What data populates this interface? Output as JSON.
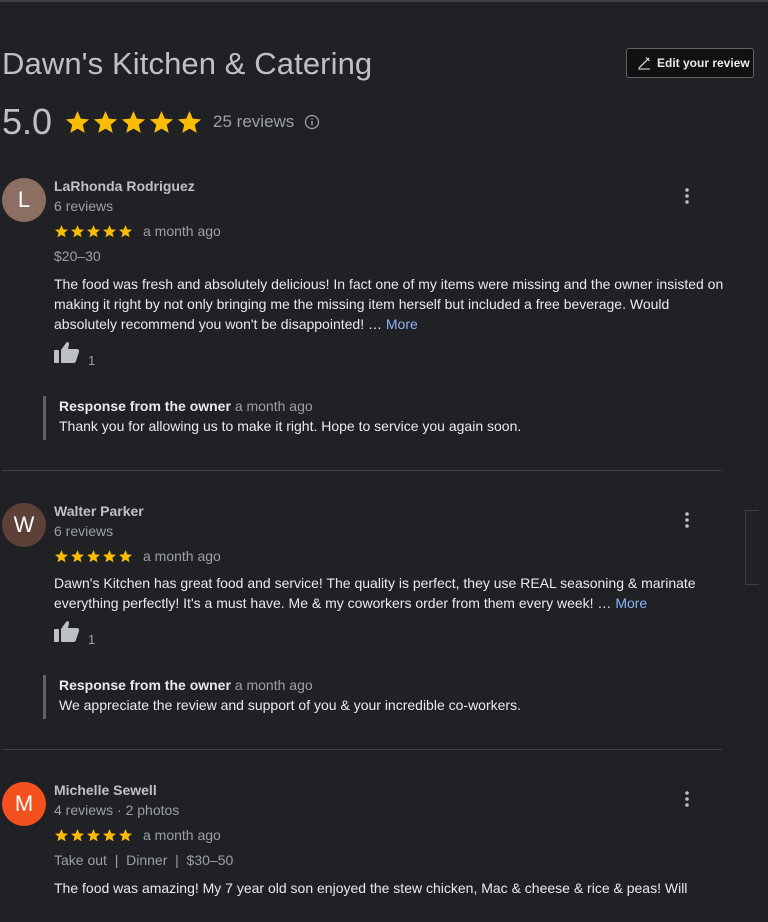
{
  "header": {
    "title": "Dawn's Kitchen & Catering",
    "edit_button_label": "Edit your review"
  },
  "summary": {
    "rating": "5.0",
    "stars": 5,
    "reviews_count": "25 reviews",
    "star_color": "#fbbc04"
  },
  "reviews": [
    {
      "initial": "L",
      "avatar_color": "#8d6e63",
      "name": "LaRhonda Rodriguez",
      "meta": "6 reviews",
      "rating": 5,
      "time": "a month ago",
      "price": "$20–30",
      "text": "The food was fresh and absolutely delicious! In fact one of my items were missing and the owner insisted on making it right by not only bringing me the missing item herself but included a free beverage. Would absolutely recommend you won't be disappointed! …",
      "more_label": "More",
      "likes": "1",
      "owner_label": "Response from the owner",
      "owner_time": "a month ago",
      "owner_text": "Thank you for allowing us to make it right. Hope to service you again soon."
    },
    {
      "initial": "W",
      "avatar_color": "#5d4037",
      "name": "Walter Parker",
      "meta": "6 reviews",
      "rating": 5,
      "time": "a month ago",
      "text": "Dawn's Kitchen has great food and service! The quality is perfect, they use REAL seasoning & marinate everything perfectly! It's a must have. Me & my coworkers order from them every week! …",
      "more_label": "More",
      "likes": "1",
      "owner_label": "Response from the owner",
      "owner_time": "a month ago",
      "owner_text": "We appreciate the review and support of you & your incredible co-workers."
    },
    {
      "initial": "M",
      "avatar_color": "#f4511e",
      "name": "Michelle Sewell",
      "meta": "4 reviews · 2 photos",
      "rating": 5,
      "time": "a month ago",
      "details": "Take out  |  Dinner  |  $30–50",
      "text": "The food was amazing! My 7 year old son enjoyed the stew chicken, Mac & cheese & rice & peas! Will"
    }
  ]
}
